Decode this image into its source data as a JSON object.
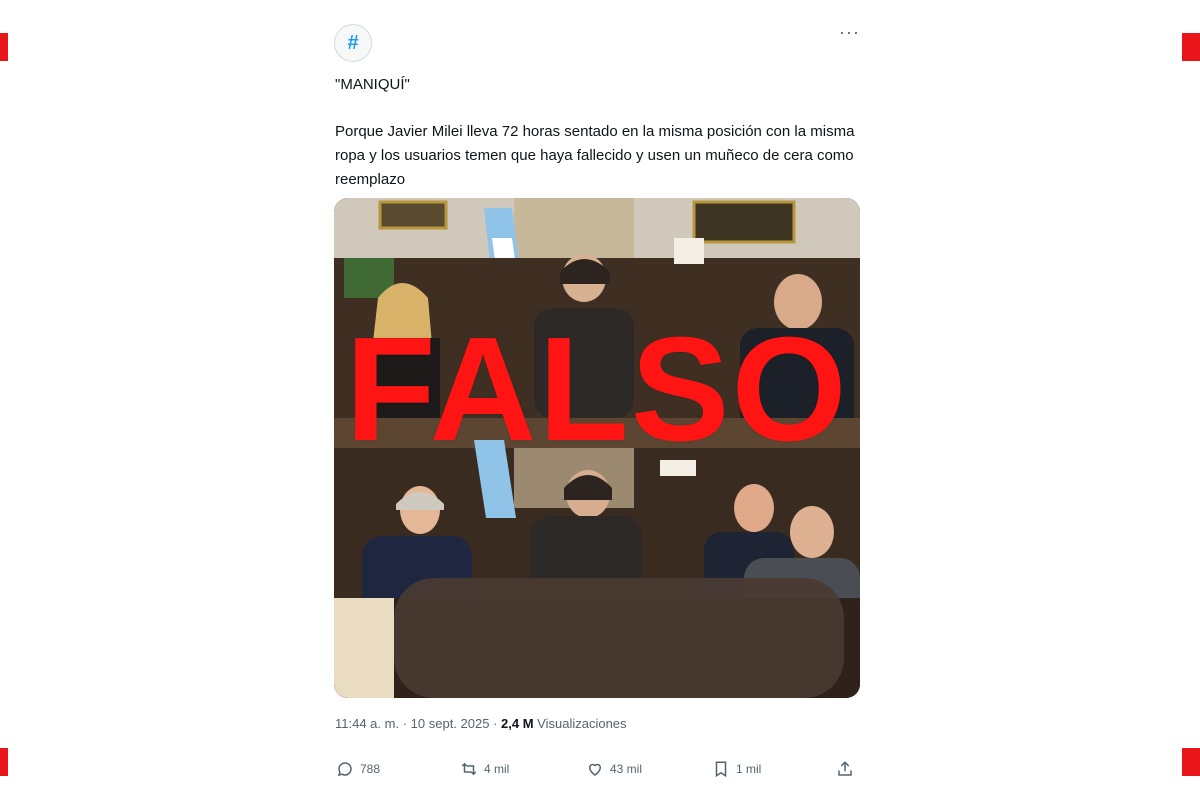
{
  "brand": {
    "accent": "#ff1414",
    "link": "#1d9bf0",
    "muted": "#536471"
  },
  "account": {
    "avatar_glyph": "#"
  },
  "menu": {
    "more_label": "···"
  },
  "tweet": {
    "title": "\"MANIQUÍ\"",
    "body": "Porque Javier Milei lleva 72 horas sentado en la misma posición con la misma ropa y los usuarios temen que haya fallecido y usen un muñeco de cera como reemplazo",
    "overlay_label": "FALSO",
    "time": "11:44 a. m.",
    "date": "10 sept. 2025",
    "views_count": "2,4 M",
    "views_label": "Visualizaciones"
  },
  "actions": {
    "reply": {
      "icon": "reply-icon",
      "count": "788"
    },
    "retweet": {
      "icon": "retweet-icon",
      "count": "4 mil"
    },
    "like": {
      "icon": "heart-icon",
      "count": "43 mil"
    },
    "bookmark": {
      "icon": "bookmark-icon",
      "count": "1 mil"
    },
    "share": {
      "icon": "share-icon"
    }
  }
}
